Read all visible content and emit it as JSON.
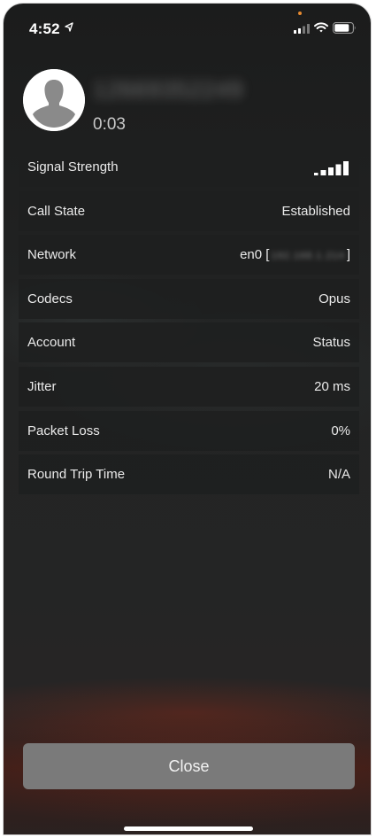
{
  "status_bar": {
    "time": "4:52",
    "icons": [
      "location-arrow-icon",
      "cellular-signal-icon",
      "wifi-icon",
      "battery-icon"
    ]
  },
  "call": {
    "phone_number": "12669352249",
    "duration": "0:03"
  },
  "info_rows": [
    {
      "label": "Signal Strength",
      "value": "",
      "icon": "signal-strength-bars-icon"
    },
    {
      "label": "Call State",
      "value": "Established"
    },
    {
      "label": "Network",
      "value_prefix": "en0 [",
      "value_blurred": "192.168.1.214",
      "value_suffix": "]"
    },
    {
      "label": "Codecs",
      "value": "Opus"
    },
    {
      "label": "Account",
      "value": "Status"
    },
    {
      "label": "Jitter",
      "value": "20 ms"
    },
    {
      "label": "Packet Loss",
      "value": "0%"
    },
    {
      "label": "Round Trip Time",
      "value": "N/A"
    }
  ],
  "close_label": "Close",
  "colors": {
    "background": "#232424",
    "row_background": "#1e1f1f",
    "button": "#7a7a7a",
    "text": "#eaeaea"
  }
}
